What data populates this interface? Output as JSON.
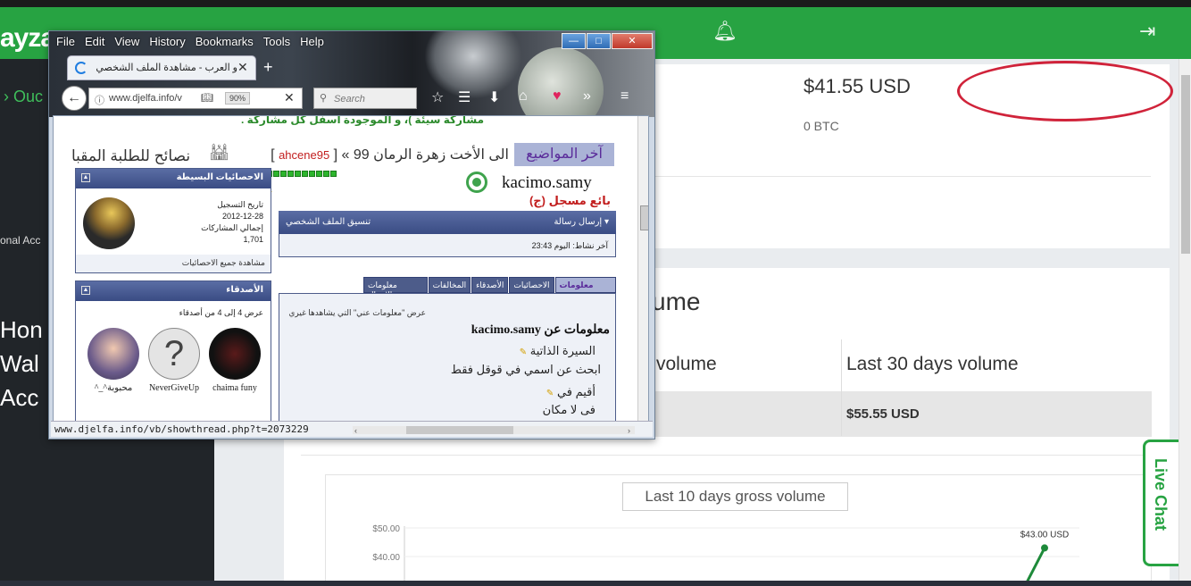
{
  "app": {
    "logo": "ayza",
    "sidebar_partial": "› Ouc",
    "sidebar_account": "onal Acc",
    "sidebar_menu": [
      "Hon",
      "Wal",
      "Acc"
    ],
    "balance_usd": "$41.55 USD",
    "balance_btc": "0 BTC",
    "volume_title": "ume",
    "col1_header": "volume",
    "col2_header": "Last 30 days volume",
    "col2_value": "$55.55 USD",
    "chart_title": "Last 10 days gross volume",
    "live_chat": "Live Chat",
    "colors": {
      "brand": "#27a342",
      "annotation": "#d0233a"
    }
  },
  "chart_data": {
    "type": "line",
    "title": "Last 10 days gross volume",
    "y_ticks": [
      "$50.00",
      "$40.00"
    ],
    "ylim": [
      0,
      50
    ],
    "point_label": "$43.00 USD",
    "values": [
      43.0
    ],
    "grid": true
  },
  "firefox": {
    "menu": [
      "File",
      "Edit",
      "View",
      "History",
      "Bookmarks",
      "Tools",
      "Help"
    ],
    "window_buttons": [
      "—",
      "□",
      "✕"
    ],
    "tab_title": "و العرب - مشاهدة الملف الشخصي",
    "url": "www.djelfa.info/v",
    "zoom": "90%",
    "search_placeholder": "Search",
    "status_url": "www.djelfa.info/vb/showthread.php?t=2073229"
  },
  "page": {
    "hint": "مشاركة سيئة )، و الموجودة أسفل كل مشاركة .",
    "latest_label": "آخر المواضيع",
    "latest_text": "الى الأخت زهرة الرمان 99 » [",
    "latest_user": "ahcene95",
    "latest_tips": "نصائح للطلبة المقبا",
    "username": "kacimo.samy",
    "rank": "بائع مسجل (ج)",
    "stats_title": "الاحصائيات البسيطة",
    "stats_lines": [
      "تاريخ التسجيل",
      "2012-12-28",
      "إجمالي المشاركات",
      "1,701"
    ],
    "stats_link": "مشاهدة جميع الاحصائيات",
    "friends_title": "الأصدقاء",
    "friends_count": "عرض 4 إلى 4 من أصدقاء",
    "friends": [
      "chaima funy",
      "NeverGiveUp",
      "^_^محبوبة"
    ],
    "send_message": "إرسال رسالة ▾",
    "profile_format": "تنسيق الملف الشخصي",
    "last_activity": "آخر نشاط: اليوم 23:43",
    "tabs": [
      "معلومات عني",
      "الاحصائيات",
      "الأصدقاء",
      "المخالفات",
      "معلومات الاتصال"
    ],
    "about_hint": "عرض \"معلومات عني\" التي يشاهدها غيري",
    "about_title": "معلومات عن kacimo.samy",
    "bio_label": "السيرة الذاتية",
    "bio_value": "ابحث عن اسمي في قوقل فقط",
    "residence_label": "أقيم في",
    "residence_value": "فى لا مكان"
  }
}
